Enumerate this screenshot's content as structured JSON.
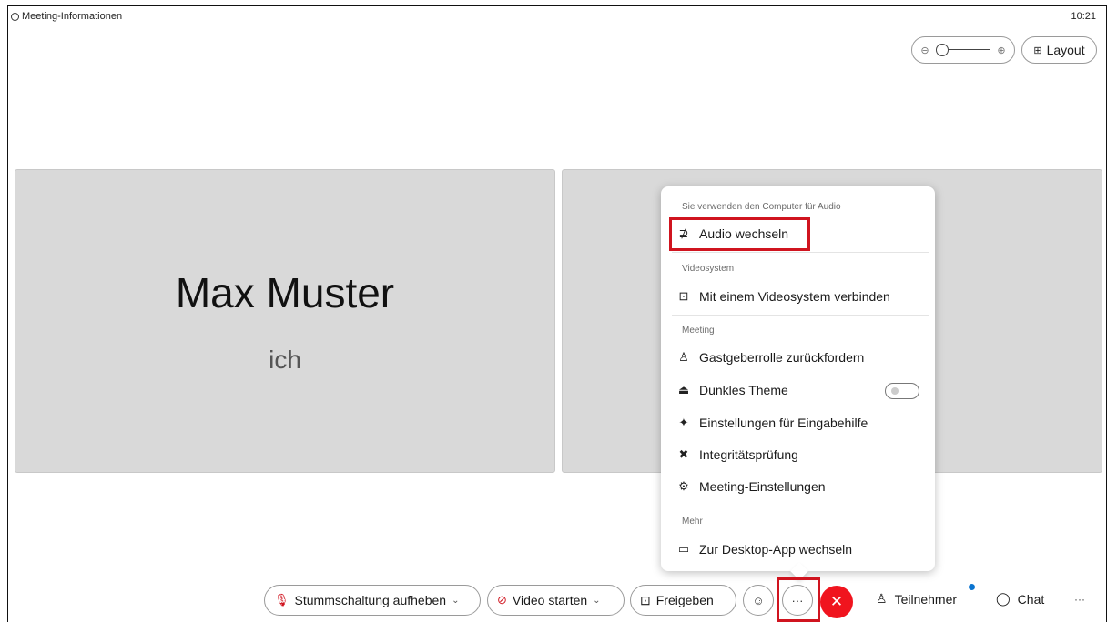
{
  "topbar": {
    "meeting_info": "Meeting-Informationen",
    "clock": "10:21"
  },
  "view_controls": {
    "zoom_out_icon": "zoom-out-icon",
    "zoom_in_icon": "zoom-in-icon",
    "zoom_level_fraction": 0.0,
    "layout_label": "Layout"
  },
  "tiles": [
    {
      "name": "Max Muster",
      "subtitle": "ich"
    }
  ],
  "menu": {
    "section_audio_header": "Sie verwenden den Computer für Audio",
    "audio_switch": "Audio wechseln",
    "section_video_header": "Videosystem",
    "video_connect": "Mit einem Videosystem verbinden",
    "section_meeting_header": "Meeting",
    "reclaim_host": "Gastgeberrolle zurückfordern",
    "dark_theme": "Dunkles Theme",
    "dark_theme_enabled": false,
    "accessibility": "Einstellungen für Eingabehilfe",
    "health_check": "Integritätsprüfung",
    "meeting_settings": "Meeting-Einstellungen",
    "section_more_header": "Mehr",
    "desktop_app": "Zur Desktop-App wechseln"
  },
  "controls": {
    "unmute": "Stummschaltung aufheben",
    "start_video": "Video starten",
    "share": "Freigeben",
    "more": "···",
    "participants": "Teilnehmer",
    "chat": "Chat",
    "overflow": "···"
  },
  "colors": {
    "highlight_red": "#d0141f",
    "leave_red": "#f0141e",
    "notification_blue": "#0a74d0",
    "tile_grey": "#d9d9d9"
  }
}
